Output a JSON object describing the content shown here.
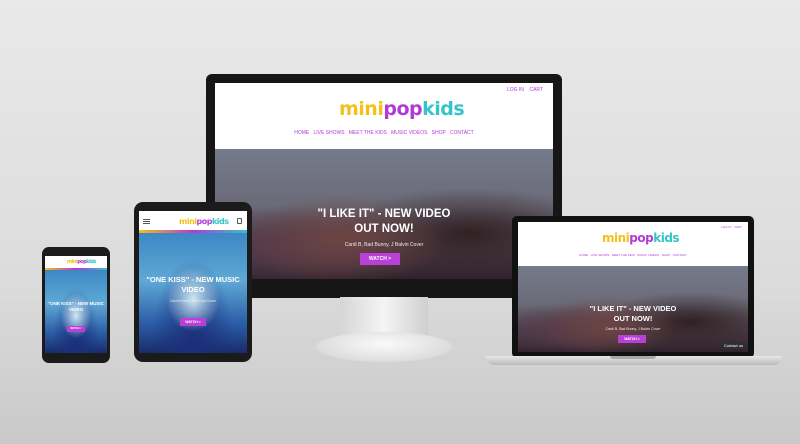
{
  "brand": {
    "logo_mini": "mini",
    "logo_pop": "pop",
    "logo_kids": "kids"
  },
  "colors": {
    "accent": "#b93fd6",
    "logo_yellow": "#f3c11b",
    "logo_purple": "#b23ad6",
    "logo_teal": "#34c4c9"
  },
  "utility": {
    "login": "LOG IN",
    "cart": "CART"
  },
  "nav": [
    "HOME",
    "LIVE SHOWS",
    "MEET THE KIDS",
    "MUSIC VIDEOS",
    "SHOP",
    "CONTACT"
  ],
  "desktop_hero": {
    "title_line1": "\"I LIKE IT\" - NEW VIDEO",
    "title_line2": "OUT NOW!",
    "subtitle": "Cardi B, Bad Bunny, J Balvin Cover",
    "button": "WATCH >"
  },
  "tablet_hero": {
    "title_line1": "\"ONE KISS\" - NEW MUSIC",
    "title_line2": "VIDEO",
    "subtitle": "Calvin Harris, Dua Lipa Cover",
    "button": "WATCH >"
  },
  "phone_hero": {
    "title_line1": "\"ONE KISS\" - NEW MUSIC",
    "title_line2": "VIDEO",
    "button": "WATCH >"
  },
  "laptop_badge": "Contact us",
  "icons": [
    "menu-icon",
    "cart-icon"
  ]
}
